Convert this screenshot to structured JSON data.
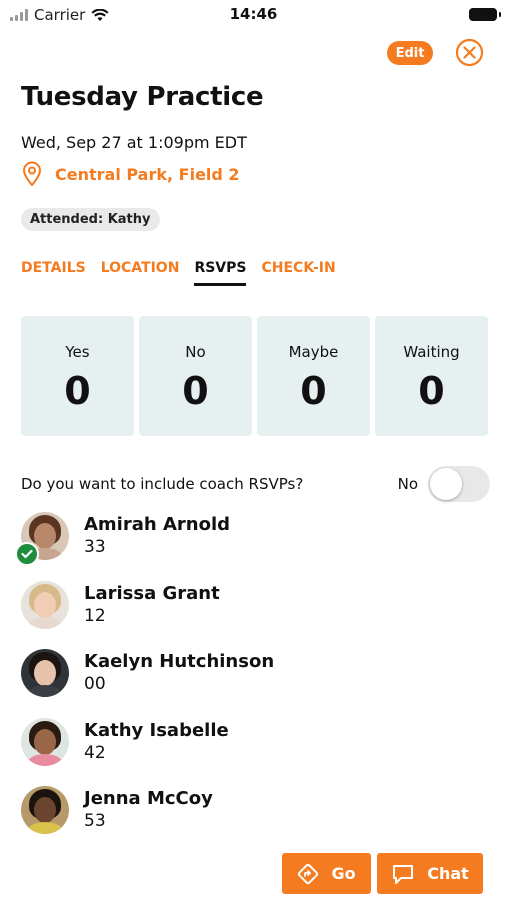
{
  "status_bar": {
    "carrier": "Carrier",
    "time": "14:46"
  },
  "header": {
    "edit_label": "Edit"
  },
  "event": {
    "title": "Tuesday Practice",
    "datetime": "Wed, Sep 27 at 1:09pm EDT",
    "location": "Central Park, Field 2",
    "attended": "Attended: Kathy"
  },
  "tabs": [
    {
      "label": "DETAILS"
    },
    {
      "label": "LOCATION"
    },
    {
      "label": "RSVPS"
    },
    {
      "label": "CHECK-IN"
    }
  ],
  "rsvp_stats": [
    {
      "label": "Yes",
      "value": "0"
    },
    {
      "label": "No",
      "value": "0"
    },
    {
      "label": "Maybe",
      "value": "0"
    },
    {
      "label": "Waiting",
      "value": "0"
    }
  ],
  "coach_rsvp": {
    "question": "Do you want to include coach RSVPs?",
    "toggle_label": "No"
  },
  "players": [
    {
      "name": "Amirah Arnold",
      "number": "33"
    },
    {
      "name": "Larissa Grant",
      "number": "12"
    },
    {
      "name": "Kaelyn Hutchinson",
      "number": "00"
    },
    {
      "name": "Kathy Isabelle",
      "number": "42"
    },
    {
      "name": "Jenna McCoy",
      "number": "53"
    }
  ],
  "actions": {
    "go_label": "Go",
    "chat_label": "Chat"
  },
  "colors": {
    "accent": "#f47b20",
    "stat_bg": "#e6f0f1",
    "check_green": "#1e8e3e"
  }
}
